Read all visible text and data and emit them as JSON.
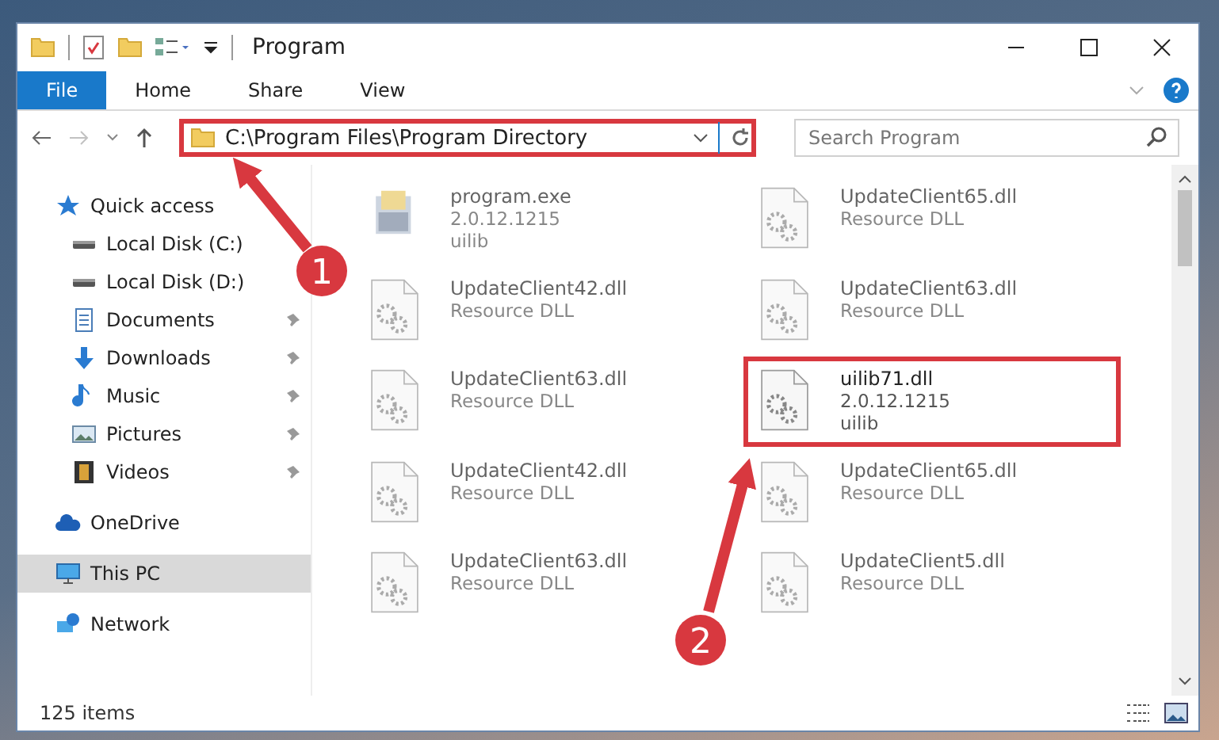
{
  "window": {
    "title": "Program"
  },
  "ribbon_tabs": [
    {
      "label": "File",
      "selected": true
    },
    {
      "label": "Home",
      "selected": false
    },
    {
      "label": "Share",
      "selected": false
    },
    {
      "label": "View",
      "selected": false
    }
  ],
  "address": {
    "path": "C:\\Program Files\\Program Directory",
    "highlighted": true
  },
  "search": {
    "placeholder": "Search Program"
  },
  "sidebar": {
    "items": [
      {
        "label": "Quick access",
        "kind": "star",
        "group": true,
        "pinned": false,
        "selected": false
      },
      {
        "label": "Local Disk (C:)",
        "kind": "drive",
        "group": false,
        "pinned": false,
        "selected": false
      },
      {
        "label": "Local Disk (D:)",
        "kind": "drive",
        "group": false,
        "pinned": false,
        "selected": false
      },
      {
        "label": "Documents",
        "kind": "document",
        "group": false,
        "pinned": true,
        "selected": false
      },
      {
        "label": "Downloads",
        "kind": "download",
        "group": false,
        "pinned": true,
        "selected": false
      },
      {
        "label": "Music",
        "kind": "music",
        "group": false,
        "pinned": true,
        "selected": false
      },
      {
        "label": "Pictures",
        "kind": "pictures",
        "group": false,
        "pinned": true,
        "selected": false
      },
      {
        "label": "Videos",
        "kind": "videos",
        "group": false,
        "pinned": true,
        "selected": false
      },
      {
        "label": "OneDrive",
        "kind": "cloud",
        "group": true,
        "pinned": false,
        "selected": false
      },
      {
        "label": "This PC",
        "kind": "pc",
        "group": true,
        "pinned": false,
        "selected": true
      },
      {
        "label": "Network",
        "kind": "network",
        "group": true,
        "pinned": false,
        "selected": false
      }
    ]
  },
  "files": [
    {
      "name": "program.exe",
      "lines": [
        "2.0.12.1215",
        "uilib"
      ],
      "kind": "exe",
      "faded": true,
      "highlighted": false
    },
    {
      "name": "UpdateClient65.dll",
      "lines": [
        "Resource DLL"
      ],
      "kind": "dll",
      "faded": true,
      "highlighted": false
    },
    {
      "name": "UpdateClient42.dll",
      "lines": [
        "Resource DLL"
      ],
      "kind": "dll",
      "faded": true,
      "highlighted": false
    },
    {
      "name": "UpdateClient63.dll",
      "lines": [
        "Resource DLL"
      ],
      "kind": "dll",
      "faded": true,
      "highlighted": false
    },
    {
      "name": "UpdateClient63.dll",
      "lines": [
        "Resource DLL"
      ],
      "kind": "dll",
      "faded": true,
      "highlighted": false
    },
    {
      "name": "uilib71.dll",
      "lines": [
        "2.0.12.1215",
        "uilib"
      ],
      "kind": "dll",
      "faded": false,
      "highlighted": true
    },
    {
      "name": "UpdateClient42.dll",
      "lines": [
        "Resource DLL"
      ],
      "kind": "dll",
      "faded": true,
      "highlighted": false
    },
    {
      "name": "UpdateClient65.dll",
      "lines": [
        "Resource DLL"
      ],
      "kind": "dll",
      "faded": true,
      "highlighted": false
    },
    {
      "name": "UpdateClient63.dll",
      "lines": [
        "Resource DLL"
      ],
      "kind": "dll",
      "faded": true,
      "highlighted": false
    },
    {
      "name": "UpdateClient5.dll",
      "lines": [
        "Resource DLL"
      ],
      "kind": "dll",
      "faded": true,
      "highlighted": false
    }
  ],
  "status_bar": {
    "count": "125 items"
  },
  "callouts": [
    {
      "number": "1"
    },
    {
      "number": "2"
    }
  ]
}
